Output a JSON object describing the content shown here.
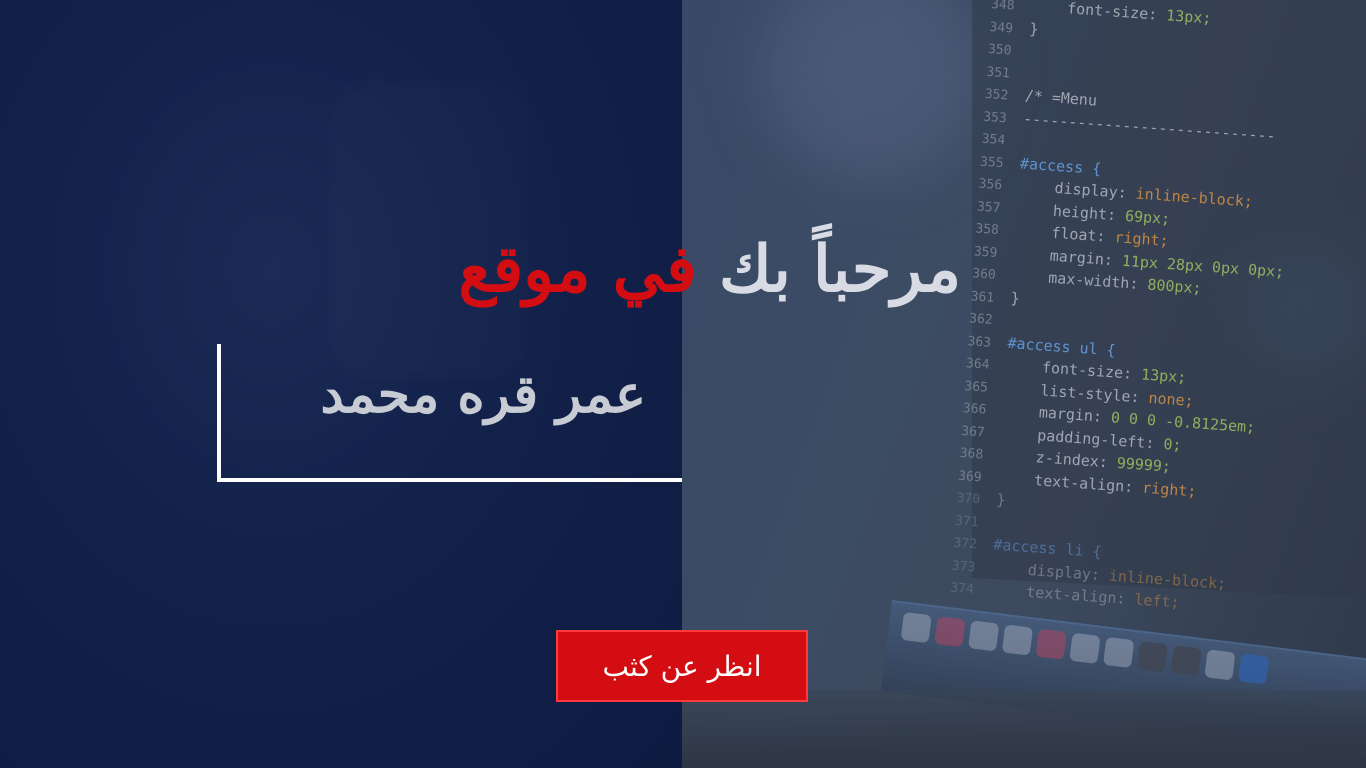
{
  "hero": {
    "greeting": "مرحباً بك",
    "highlight": "في موقع",
    "name": "عمر قره محمد",
    "cta_label": "انظر عن كثب",
    "colors": {
      "primary_bg": "#0f1d44",
      "accent": "#d40d12",
      "text": "#d8dbe3"
    }
  },
  "code": {
    "lines": [
      {
        "n": "348",
        "t": "    font-size: 13px;"
      },
      {
        "n": "349",
        "t": "}"
      },
      {
        "n": "350",
        "t": ""
      },
      {
        "n": "351",
        "t": ""
      },
      {
        "n": "352",
        "t": "/* =Menu"
      },
      {
        "n": "353",
        "t": "----------------------------"
      },
      {
        "n": "354",
        "t": ""
      },
      {
        "n": "355",
        "t": "#access {"
      },
      {
        "n": "356",
        "t": "    display: inline-block;"
      },
      {
        "n": "357",
        "t": "    height: 69px;"
      },
      {
        "n": "358",
        "t": "    float: right;"
      },
      {
        "n": "359",
        "t": "    margin: 11px 28px 0px 0px;"
      },
      {
        "n": "360",
        "t": "    max-width: 800px;"
      },
      {
        "n": "361",
        "t": "}"
      },
      {
        "n": "362",
        "t": ""
      },
      {
        "n": "363",
        "t": "#access ul {"
      },
      {
        "n": "364",
        "t": "    font-size: 13px;"
      },
      {
        "n": "365",
        "t": "    list-style: none;"
      },
      {
        "n": "366",
        "t": "    margin: 0 0 0 -0.8125em;"
      },
      {
        "n": "367",
        "t": "    padding-left: 0;"
      },
      {
        "n": "368",
        "t": "    z-index: 99999;"
      },
      {
        "n": "369",
        "t": "    text-align: right;"
      },
      {
        "n": "370",
        "t": "}"
      },
      {
        "n": "371",
        "t": ""
      },
      {
        "n": "372",
        "t": "#access li {"
      },
      {
        "n": "373",
        "t": "    display: inline-block;"
      },
      {
        "n": "374",
        "t": "    text-align: left;"
      }
    ]
  }
}
